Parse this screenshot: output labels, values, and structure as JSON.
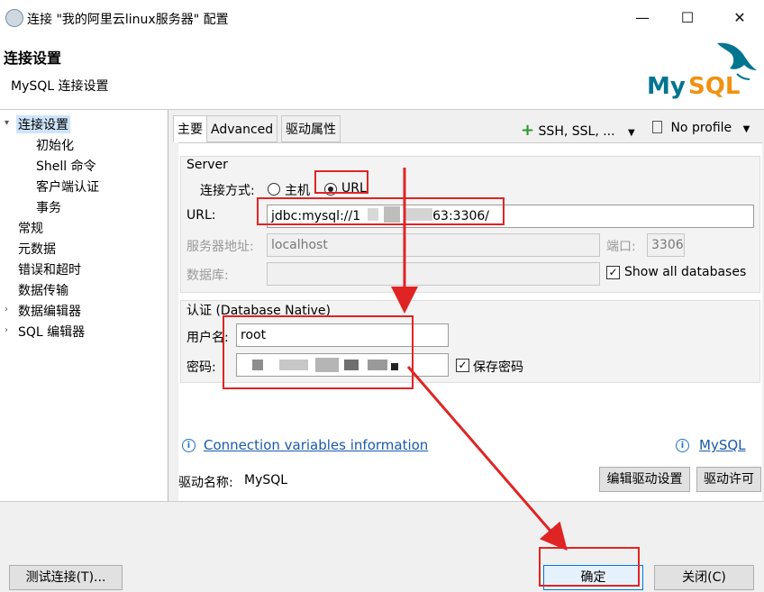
{
  "window": {
    "title": "连接 \"我的阿里云linux服务器\" 配置",
    "minimize": "—",
    "maximize": "☐",
    "close": "✕"
  },
  "header": {
    "title": "连接设置",
    "subtitle": "MySQL 连接设置",
    "logo": "MySQL"
  },
  "sidebar": {
    "items": [
      {
        "label": "连接设置",
        "level": 0,
        "expanded": true,
        "selected": true
      },
      {
        "label": "初始化",
        "level": 1
      },
      {
        "label": "Shell 命令",
        "level": 1
      },
      {
        "label": "客户端认证",
        "level": 1
      },
      {
        "label": "事务",
        "level": 1
      },
      {
        "label": "常规",
        "level": 0
      },
      {
        "label": "元数据",
        "level": 0
      },
      {
        "label": "错误和超时",
        "level": 0
      },
      {
        "label": "数据传输",
        "level": 0
      },
      {
        "label": "数据编辑器",
        "level": 0,
        "expandable": true
      },
      {
        "label": "SQL 编辑器",
        "level": 0,
        "expandable": true
      }
    ]
  },
  "tabs": [
    {
      "label": "主要",
      "active": true
    },
    {
      "label": "Advanced"
    },
    {
      "label": "驱动属性"
    }
  ],
  "toolbar": {
    "ssh_label": "SSH, SSL, ...",
    "profile_label": "No profile"
  },
  "server": {
    "group_title": "Server",
    "connect_method_label": "连接方式:",
    "option_host": "主机",
    "option_url": "URL",
    "selected": "URL",
    "url_label": "URL:",
    "url_value_prefix": "jdbc:mysql://1",
    "url_value_suffix": "63:3306/",
    "host_label": "服务器地址:",
    "host_value": "localhost",
    "port_label": "端口:",
    "port_value": "3306",
    "database_label": "数据库:",
    "database_value": "",
    "show_all_db_label": "Show all databases",
    "show_all_db_checked": true
  },
  "auth": {
    "group_title": "认证 (Database Native)",
    "username_label": "用户名:",
    "username_value": "root",
    "password_label": "密码:",
    "save_password_label": "保存密码",
    "save_password_checked": true
  },
  "links": {
    "connection_vars": "Connection variables information",
    "mysql": "MySQL"
  },
  "driver": {
    "label": "驱动名称:",
    "value": "MySQL",
    "edit_button": "编辑驱动设置",
    "license_button": "驱动许可"
  },
  "footer": {
    "test_button": "测试连接(T)...",
    "ok_button": "确定",
    "close_button": "关闭(C)"
  },
  "colors": {
    "annotation": "#e02424",
    "link": "#1a5aa8",
    "selection": "#cde4fb",
    "mysql_blue": "#00758f",
    "mysql_orange": "#f29111"
  }
}
